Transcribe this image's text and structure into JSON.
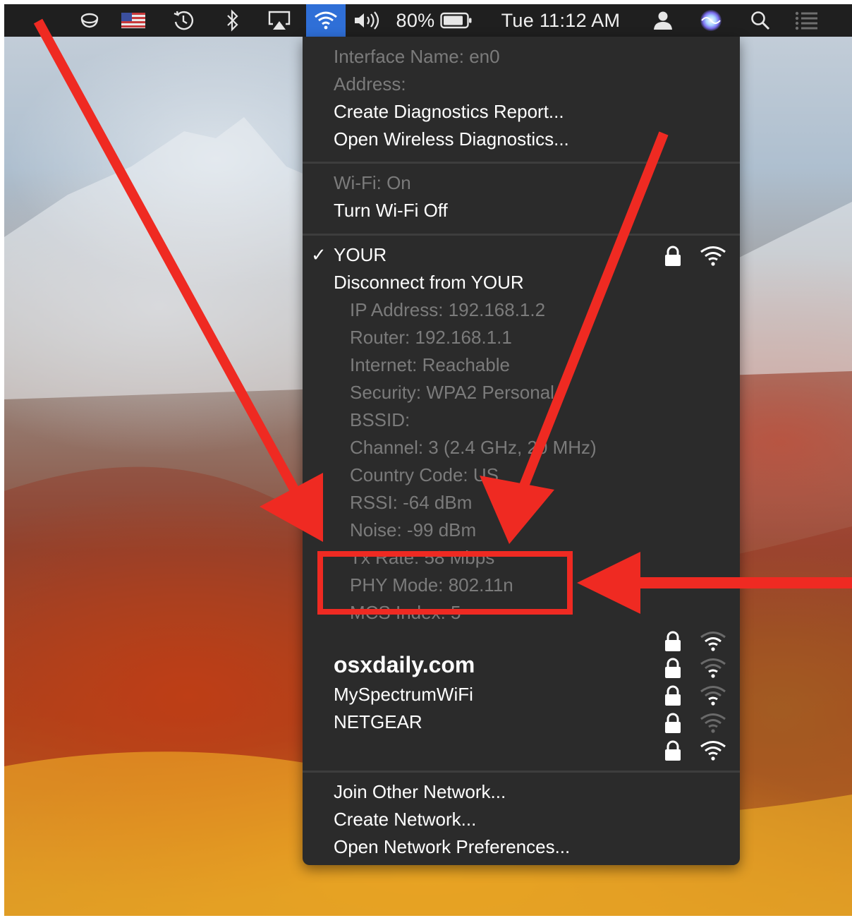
{
  "menubar": {
    "battery": "80%",
    "clock": "Tue 11:12 AM",
    "icons": [
      "coffee-cup-icon",
      "us-flag-icon",
      "time-machine-icon",
      "bluetooth-icon",
      "airplay-icon",
      "wifi-icon",
      "volume-icon",
      "battery-icon",
      "user-icon",
      "siri-icon",
      "spotlight-search-icon",
      "notification-center-icon"
    ]
  },
  "wifi_menu": {
    "interface_name": "Interface Name: en0",
    "address": "Address:",
    "create_diagnostics": "Create Diagnostics Report...",
    "open_wireless_diagnostics": "Open Wireless Diagnostics...",
    "wifi_status": "Wi-Fi: On",
    "turn_wifi_off": "Turn Wi-Fi Off",
    "connected_network": "YOUR",
    "disconnect": "Disconnect from YOUR",
    "details": [
      "IP Address: 192.168.1.2",
      "Router: 192.168.1.1",
      "Internet: Reachable",
      "Security: WPA2 Personal",
      "BSSID:",
      "Channel: 3 (2.4 GHz, 20 MHz)",
      "Country Code: US",
      "RSSI: -64 dBm",
      "Noise: -99 dBm",
      "Tx Rate: 58 Mbps",
      "PHY Mode: 802.11n",
      "MCS Index: 5"
    ],
    "other_networks": [
      "osxdaily.com",
      "MySpectrumWiFi",
      "NETGEAR"
    ],
    "join_other": "Join Other Network...",
    "create_network": "Create Network...",
    "open_prefs": "Open Network Preferences..."
  },
  "colors": {
    "menu_bg": "#2b2b2b",
    "highlight_red": "#ef2a22",
    "wifi_selected_blue": "#2f6fd7"
  }
}
